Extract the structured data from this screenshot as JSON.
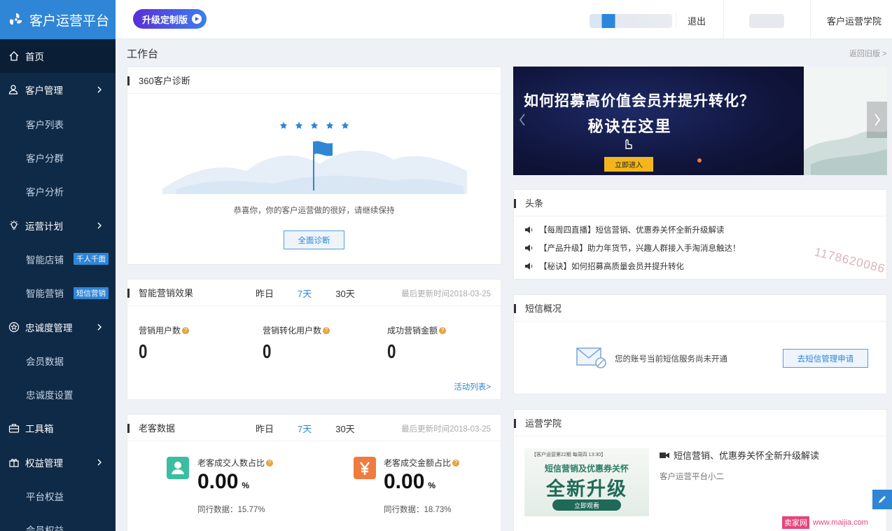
{
  "app": {
    "title": "客户运营平台"
  },
  "header": {
    "upgrade_label": "升级定制版",
    "logout": "退出",
    "academy": "客户运营学院"
  },
  "sidebar": {
    "items": [
      {
        "label": "首页"
      },
      {
        "label": "客户管理"
      },
      {
        "label": "客户列表"
      },
      {
        "label": "客户分群"
      },
      {
        "label": "客户分析"
      },
      {
        "label": "运营计划"
      },
      {
        "label": "智能店铺",
        "tag": "千人千面"
      },
      {
        "label": "智能营销",
        "tag": "短信营销"
      },
      {
        "label": "忠诚度管理"
      },
      {
        "label": "会员数据"
      },
      {
        "label": "忠诚度设置"
      },
      {
        "label": "工具箱"
      },
      {
        "label": "权益管理"
      },
      {
        "label": "平台权益"
      },
      {
        "label": "会员权益"
      }
    ]
  },
  "page": {
    "title": "工作台",
    "back_old": "返回旧版 >"
  },
  "diagnosis": {
    "title": "360客户诊断",
    "message": "恭喜你，你的客户运营做的很好，请继续保持",
    "button": "全面诊断"
  },
  "marketing": {
    "title": "智能营销效果",
    "tabs": [
      "昨日",
      "7天",
      "30天"
    ],
    "active_tab": "7天",
    "updated": "最后更新时间2018-03-25",
    "stats": [
      {
        "label": "营销用户数",
        "value": "0"
      },
      {
        "label": "营销转化用户数",
        "value": "0"
      },
      {
        "label": "成功营销金额",
        "value": "0"
      }
    ],
    "link": "活动列表>"
  },
  "old_customers": {
    "title": "老客数据",
    "tabs": [
      "昨日",
      "7天",
      "30天"
    ],
    "active_tab": "7天",
    "updated": "最后更新时间2018-03-25",
    "stats": [
      {
        "label": "老客成交人数占比",
        "value": "0.00",
        "unit": "%",
        "peer": "同行数据：15.77%",
        "color": "#3bbda0"
      },
      {
        "label": "老客成交金额占比",
        "value": "0.00",
        "unit": "%",
        "peer": "同行数据：18.73%",
        "color": "#f07b3f"
      }
    ]
  },
  "banner": {
    "line1": "如何招募高价值会员并提升转化？",
    "line2": "秘诀在这里",
    "button": "立即进入"
  },
  "headlines": {
    "title": "头条",
    "items": [
      "【每周四直播】短信营销、优惠券关怀全新升级解读",
      "【产品升级】助力年货节，兴趣人群接入手淘消息触达！",
      "【秘诀】如何招募高质量会员并提升转化"
    ]
  },
  "sms": {
    "title": "短信概况",
    "message": "您的账号当前短信服务尚未开通",
    "button": "去短信管理申请"
  },
  "academy": {
    "title": "运营学院",
    "video_title": "短信营销、优惠券关怀全新升级解读",
    "author": "客户运营平台小二",
    "thumb_top": "【客户运营第22期 每周四 13:30】",
    "thumb_sub": "短信营销及优惠券关怀",
    "thumb_main": "全新升级",
    "thumb_btn": "立即观看"
  },
  "watermark": {
    "number": "1178620086",
    "site": "卖家网",
    "url": "www.maijia.com"
  },
  "colors": {
    "brand": "#2f86d6",
    "sidebar": "#0f2a47",
    "accent_orange": "#f07b3f",
    "accent_teal": "#3bbda0"
  }
}
